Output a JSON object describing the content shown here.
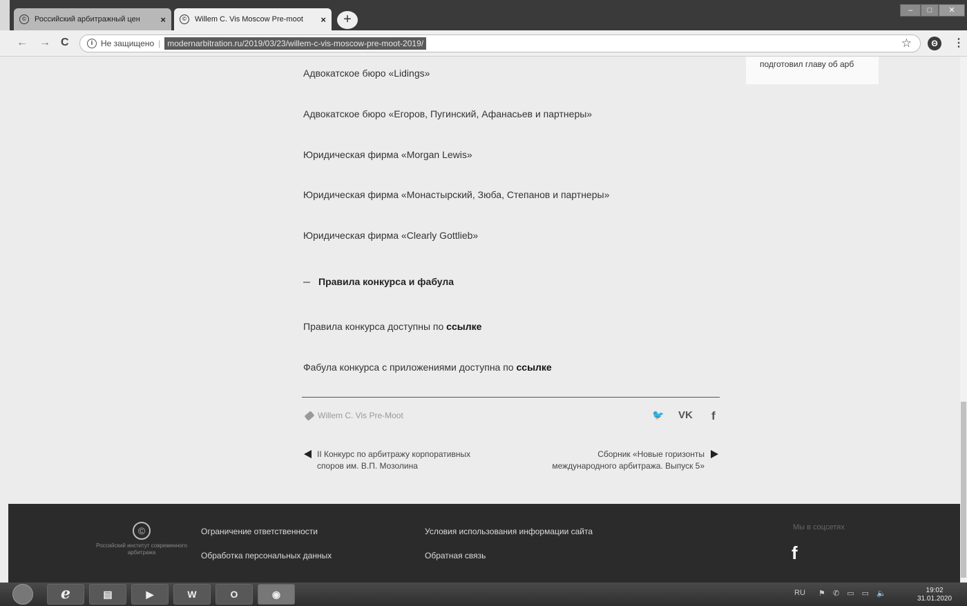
{
  "browser": {
    "tabs": [
      {
        "title": "Российский арбитражный цен",
        "close": "×"
      },
      {
        "title": "Willem C. Vis Moscow Pre-moot",
        "close": "×"
      }
    ],
    "new_tab": "+",
    "window_controls": [
      "–",
      "□",
      "✕"
    ],
    "nav": {
      "back": "←",
      "forward": "→",
      "reload": "C"
    },
    "security_label": "Не защищено",
    "url": "modernarbitration.ru/2019/03/23/willem-c-vis-moscow-pre-moot-2019/",
    "account_initial": "Θ",
    "menu": "⋮"
  },
  "sidebar_card": {
    "text": "подготовил главу об арб"
  },
  "partners": [
    "Адвокатское бюро «Lidings»",
    "Адвокатское бюро «Егоров, Пугинский, Афанасьев и партнеры»",
    "Юридическая фирма «Morgan Lewis»",
    "Юридическая фирма «Монастырский, Зюба, Степанов и партнеры»",
    "Юридическая фирма «Clearly Gottlieb»"
  ],
  "section": {
    "title": "Правила конкурса и фабула"
  },
  "rules": {
    "text": "Правила конкурса доступны по ",
    "link": "ссылке"
  },
  "fabula": {
    "text": "Фабула конкурса с приложениями доступна по ",
    "link": "ссылке"
  },
  "tag": {
    "label": "Willem C. Vis Pre-Moot"
  },
  "share": {
    "twitter": "🐦",
    "vk": "VK",
    "facebook": "f"
  },
  "prev_post": {
    "title": "II Конкурс по арбитражу корпоративных споров им. В.П. Мозолина"
  },
  "next_post": {
    "title": "Сборник «Новые горизонты международного арбитража. Выпуск 5»"
  },
  "footer": {
    "logo_text": "Российский институт современного арбитража",
    "links": {
      "disclaimer": "Ограничение ответственности",
      "personal_data": "Обработка персональных данных",
      "terms": "Условия использования информации сайта",
      "feedback": "Обратная связь"
    },
    "social_heading": "Мы в соцсетях",
    "facebook": "f"
  },
  "taskbar": {
    "apps": [
      "e",
      "▤",
      "▶",
      "W",
      "O",
      "◉"
    ],
    "lang": "RU",
    "time": "19:02",
    "date": "31.01.2020"
  }
}
